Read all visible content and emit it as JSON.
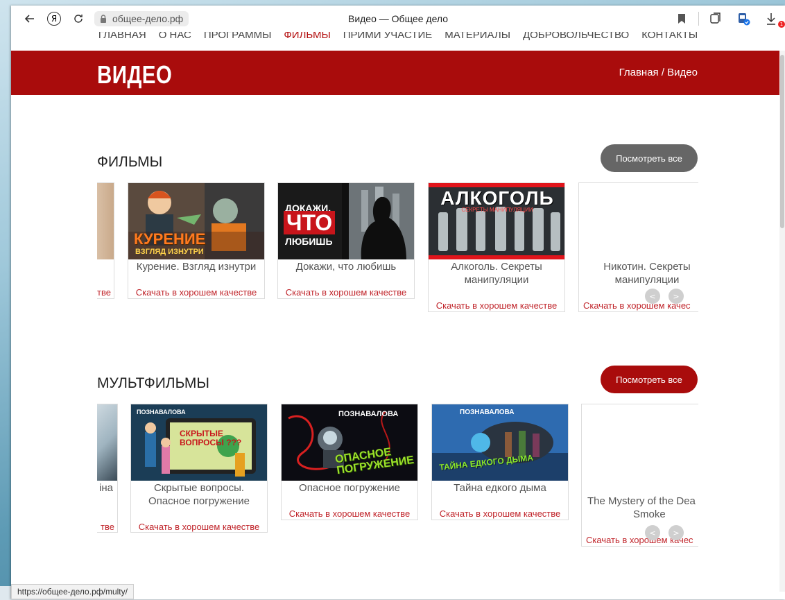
{
  "browser": {
    "address": "общее-дело.рф",
    "tab_title": "Видео — Общее дело",
    "status_url": "https://общее-дело.рф/multy/",
    "download_badge": "1"
  },
  "nav": {
    "items": [
      "ГЛАВНАЯ",
      "О НАС",
      "ПРОГРАММЫ",
      "ФИЛЬМЫ",
      "ПРИМИ УЧАСТИЕ",
      "МАТЕРИАЛЫ",
      "ДОБРОВОЛЬЧЕСТВО",
      "КОНТАКТЫ"
    ],
    "active": "ФИЛЬМЫ"
  },
  "banner": {
    "title": "ВИДЕО",
    "breadcrumb": "Главная / Видео"
  },
  "films": {
    "title": "ФИЛЬМЫ",
    "view_all": "Посмотреть все",
    "button_color": "#666666",
    "partial_left": {
      "caption": "",
      "download": "тве"
    },
    "cards": [
      {
        "caption": "Курение. Взгляд изнутри",
        "download": "Скачать в хорошем качестве",
        "thumb_text": "КУРЕНИЕ",
        "thumb_sub": "ВЗГЛЯД ИЗНУТРИ"
      },
      {
        "caption": "Докажи, что любишь",
        "download": "Скачать в хорошем качестве",
        "thumb_l1": "ДОКАЖИ,",
        "thumb_l2": "ЧТО",
        "thumb_l3": "ЛЮБИШЬ"
      },
      {
        "caption_l1": "Алкоголь. Секреты",
        "caption_l2": "манипуляции",
        "download": "Скачать в хорошем качестве",
        "thumb_text": "АЛКОГОЛЬ",
        "thumb_sub": "СЕКРЕТЫ МАНИПУЛЯЦИИ"
      },
      {
        "caption_l1": "Никотин. Секреты",
        "caption_l2": "манипуляции",
        "download": "Скачать в хорошем качес"
      }
    ]
  },
  "cartoons": {
    "title": "МУЛЬТФИЛЬМЫ",
    "view_all": "Посмотреть все",
    "button_color": "#a90c0c",
    "partial_left": {
      "caption": "іна",
      "download": "тве"
    },
    "cards": [
      {
        "caption_l1": "Скрытые вопросы.",
        "caption_l2": "Опасное погружение",
        "download": "Скачать в хорошем качестве",
        "thumb_text": "СКРЫТЫЕ ВОПРОСЫ ???",
        "brand": "ПОЗНАВАЛОВА"
      },
      {
        "caption": "Опасное погружение",
        "download": "Скачать в хорошем качестве",
        "thumb_text": "ОПАСНОЕ ПОГРУЖЕНИЕ",
        "brand": "ПОЗНАВАЛОВА"
      },
      {
        "caption": "Тайна едкого дыма",
        "download": "Скачать в хорошем качестве",
        "thumb_text": "ТАЙНА ЕДКОГО ДЫМА",
        "brand": "ПОЗНАВАЛОВА"
      },
      {
        "caption_l1": "The Mystery of the Dea",
        "caption_l2": "Smoke",
        "download": "Скачать в хорошем качес"
      }
    ]
  },
  "arrows": {
    "prev": "<",
    "next": ">"
  }
}
